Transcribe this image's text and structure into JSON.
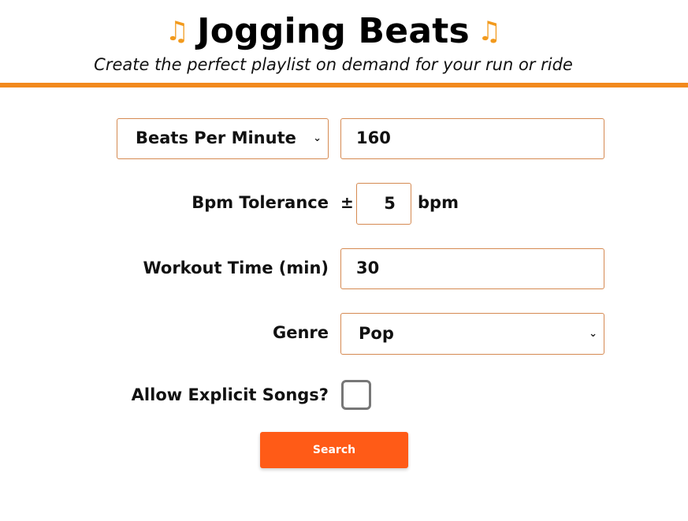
{
  "header": {
    "title": "Jogging Beats",
    "note_icon": "music-note-icon",
    "note_glyph": "♫",
    "subtitle": "Create the perfect playlist on demand for your run or ride",
    "accent_color": "#f2891d"
  },
  "form": {
    "metric_select": {
      "value": "Beats Per Minute",
      "chevron": "⌄"
    },
    "bpm_input": {
      "value": "160"
    },
    "tolerance": {
      "label": "Bpm Tolerance",
      "prefix": "±",
      "value": "5",
      "unit": "bpm"
    },
    "workout": {
      "label": "Workout Time (min)",
      "value": "30"
    },
    "genre": {
      "label": "Genre",
      "value": "Pop",
      "chevron": "⌄"
    },
    "explicit": {
      "label": "Allow Explicit Songs?",
      "checked": false
    },
    "search_button": {
      "label": "Search",
      "color": "#ff5b17"
    }
  }
}
